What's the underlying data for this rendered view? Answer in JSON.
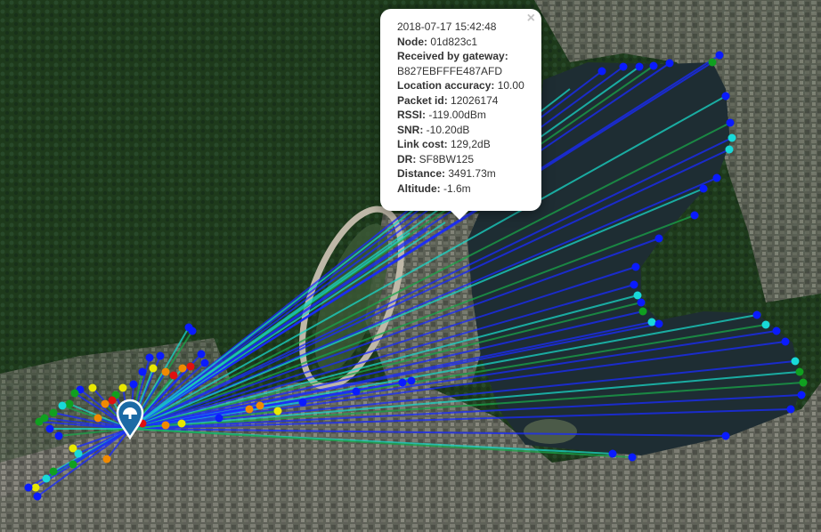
{
  "popup": {
    "timestamp": "2018-07-17 15:42:48",
    "close_symbol": "×",
    "fields": [
      {
        "label": "Node:",
        "value": "01d823c1"
      },
      {
        "label": "Received by gateway:",
        "value": ""
      },
      {
        "label": "",
        "value": "B827EBFFFE487AFD"
      },
      {
        "label": "Location accuracy:",
        "value": "10.00"
      },
      {
        "label": "Packet id:",
        "value": "12026174"
      },
      {
        "label": "RSSI:",
        "value": "-119.00dBm"
      },
      {
        "label": "SNR:",
        "value": "-10.20dB"
      },
      {
        "label": "Link cost:",
        "value": "129,2dB"
      },
      {
        "label": "DR:",
        "value": "SF8BW125"
      },
      {
        "label": "Distance:",
        "value": "3491.73m"
      },
      {
        "label": "Altitude:",
        "value": "-1.6m"
      }
    ]
  },
  "marker_icon": "map-pin-icon",
  "colors": {
    "link_blue": "#1a2bff",
    "link_teal": "#19d7c7",
    "link_green": "#1aa64a",
    "pt_blue": "#0a1bff",
    "pt_cyan": "#18d9d9",
    "pt_green": "#10a020",
    "pt_yellow": "#e8e800",
    "pt_orange": "#f08a00",
    "pt_red": "#e01010",
    "water": "#1e2d33",
    "vegetation": "#1f3a1c",
    "urban": "#6d6a66"
  }
}
